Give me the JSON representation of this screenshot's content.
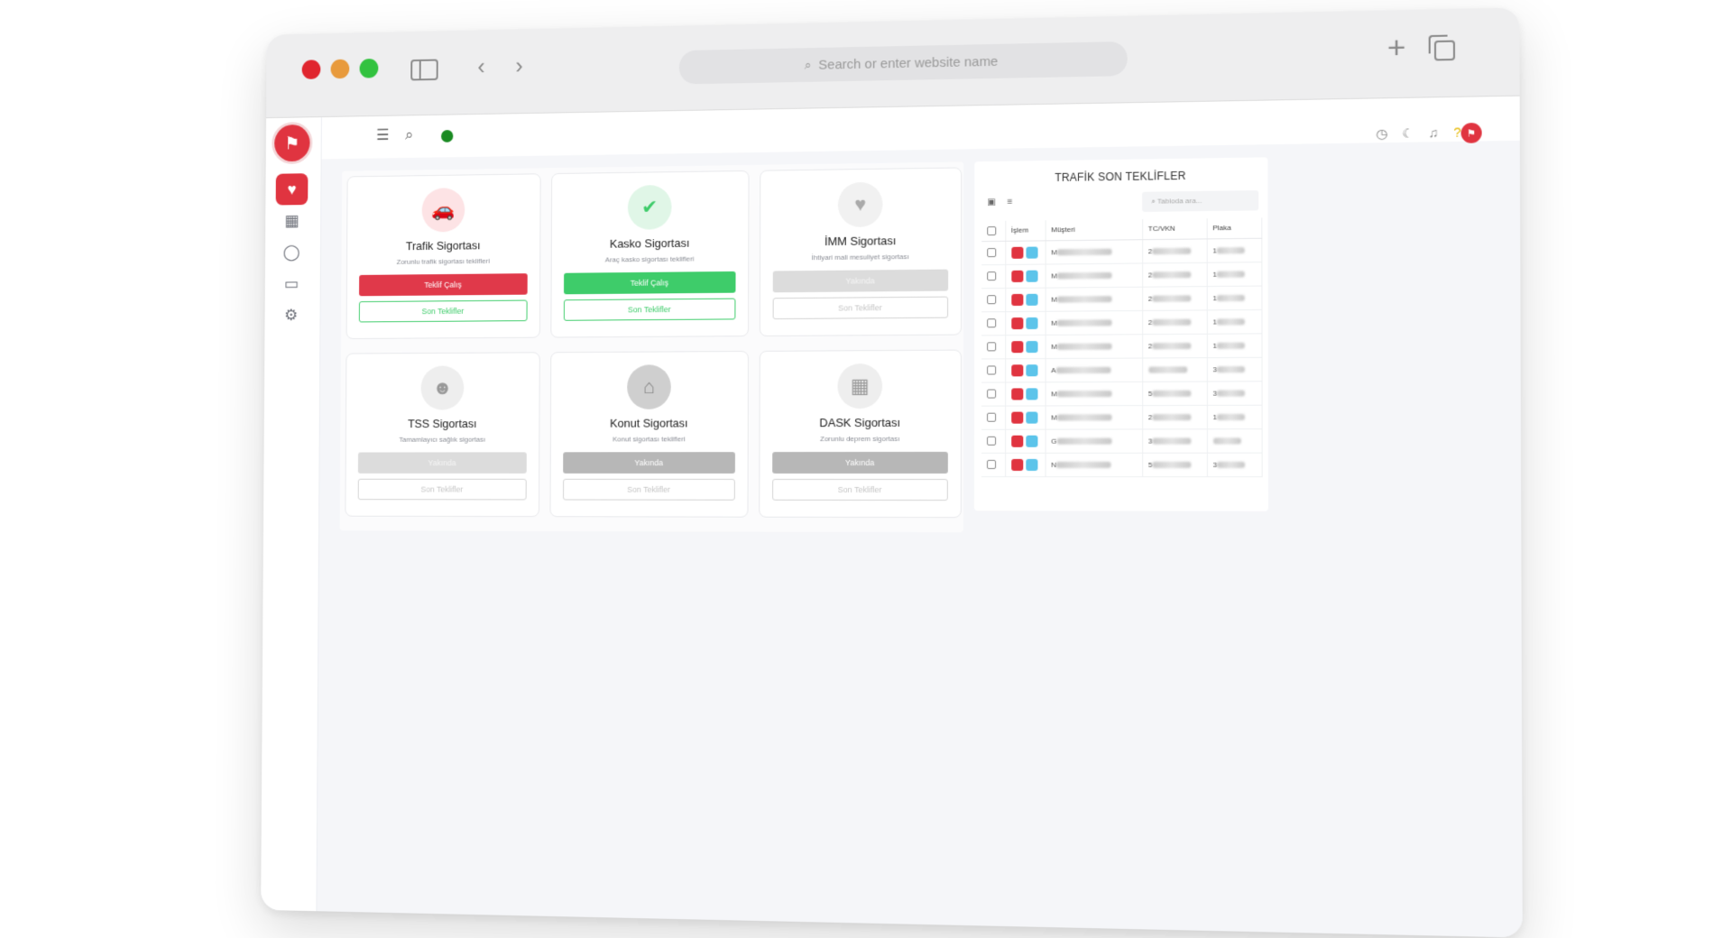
{
  "browser": {
    "address_placeholder": "Search or enter website name"
  },
  "app": {
    "cards": [
      {
        "title": "Trafik Sigortası",
        "subtitle": "Zorunlu trafik sigortası teklifleri",
        "primary": "Teklif Çalış",
        "secondary": "Son Teklifler"
      },
      {
        "title": "Kasko Sigortası",
        "subtitle": "Araç kasko sigortası teklifleri",
        "primary": "Teklif Çalış",
        "secondary": "Son Teklifler"
      },
      {
        "title": "İMM Sigortası",
        "subtitle": "İhtiyari mali mesuliyet sigortası",
        "primary": "Yakında",
        "secondary": "Son Teklifler"
      },
      {
        "title": "TSS Sigortası",
        "subtitle": "Tamamlayıcı sağlık sigortası",
        "primary": "Yakında",
        "secondary": "Son Teklifler"
      },
      {
        "title": "Konut Sigortası",
        "subtitle": "Konut sigortası teklifleri",
        "primary": "Yakında",
        "secondary": "Son Teklifler"
      },
      {
        "title": "DASK Sigortası",
        "subtitle": "Zorunlu deprem sigortası",
        "primary": "Yakında",
        "secondary": "Son Teklifler"
      }
    ],
    "panel": {
      "title": "TRAFİK SON TEKLİFLER",
      "search_placeholder": "Tabloda ara...",
      "columns": [
        "İşlem",
        "Müşteri",
        "TC/VKN",
        "Plaka"
      ],
      "rows": [
        {
          "musteri": "M",
          "tc": "2",
          "plaka": "1"
        },
        {
          "musteri": "M",
          "tc": "2",
          "plaka": "1"
        },
        {
          "musteri": "M",
          "tc": "2",
          "plaka": "1"
        },
        {
          "musteri": "M",
          "tc": "2",
          "plaka": "1"
        },
        {
          "musteri": "M",
          "tc": "2",
          "plaka": "1"
        },
        {
          "musteri": "A",
          "tc": "",
          "plaka": "3"
        },
        {
          "musteri": "M",
          "tc": "5",
          "plaka": "3"
        },
        {
          "musteri": "M",
          "tc": "2",
          "plaka": "1"
        },
        {
          "musteri": "G",
          "tc": "3",
          "plaka": ""
        },
        {
          "musteri": "N",
          "tc": "5",
          "plaka": "3"
        }
      ]
    }
  }
}
